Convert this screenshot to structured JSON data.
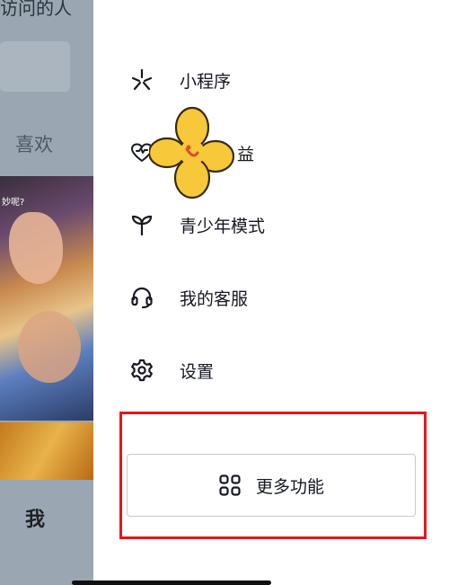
{
  "background": {
    "visitor_text": "访问的人",
    "like_tab": "喜欢",
    "me_tab": "我",
    "photo_caption": "妙呢?"
  },
  "drawer": {
    "items": [
      {
        "label": "小程序",
        "icon": "mini-program-icon"
      },
      {
        "label": "益",
        "icon": "heart-benefit-icon"
      },
      {
        "label": "青少年模式",
        "icon": "sprout-icon"
      },
      {
        "label": "我的客服",
        "icon": "headset-icon"
      },
      {
        "label": "设置",
        "icon": "gear-icon"
      }
    ],
    "more_button": {
      "label": "更多功能",
      "icon": "grid-apps-icon"
    }
  },
  "colors": {
    "highlight": "#e5161b",
    "text": "#161823",
    "overlay": "#9aa7b3"
  }
}
